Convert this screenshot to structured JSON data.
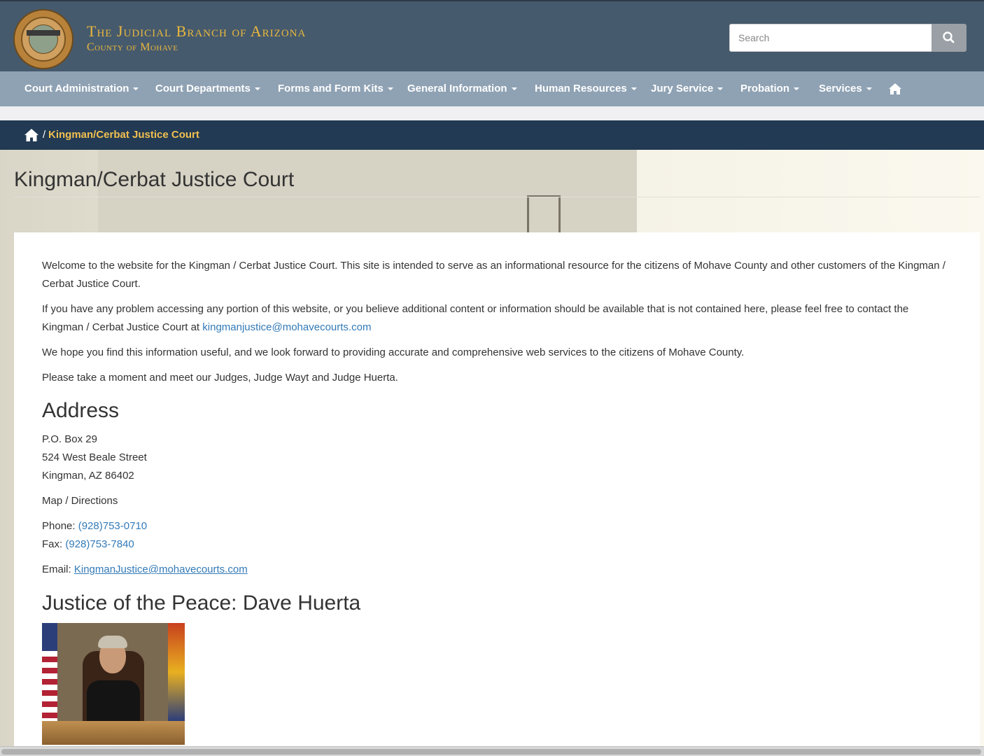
{
  "header": {
    "title": "The Judicial Branch of Arizona",
    "subtitle": "County of Mohave",
    "seal_motto": "DITAT DEUS",
    "search_placeholder": "Search"
  },
  "nav": {
    "items": [
      {
        "label": "Court Administration"
      },
      {
        "label": "Court Departments"
      },
      {
        "label": "Forms and Form Kits"
      },
      {
        "label": "General Information"
      },
      {
        "label": "Human Resources"
      },
      {
        "label": "Jury Service"
      },
      {
        "label": "Probation"
      },
      {
        "label": "Services"
      }
    ]
  },
  "breadcrumb": {
    "separator": "/",
    "current": "Kingman/Cerbat Justice Court"
  },
  "page": {
    "title": "Kingman/Cerbat Justice Court",
    "intro_1": "Welcome to the website for the Kingman / Cerbat Justice Court. This site is intended to serve as an informational resource for the citizens of Mohave County and other customers of the Kingman / Cerbat Justice Court.",
    "intro_2_text": "If you have any problem accessing any portion of this website, or you believe additional content or information should be available that is not contained here, please feel free to contact the Kingman / Cerbat Justice Court at ",
    "intro_2_link": "kingmanjustice@mohavecourts.com",
    "intro_3": "We hope you find this information useful, and we look forward to providing accurate and comprehensive web services to the citizens of Mohave County.",
    "intro_4": "Please take a moment and meet our Judges, Judge Wayt and Judge Huerta."
  },
  "address": {
    "heading": "Address",
    "line_1": "P.O. Box 29",
    "line_2": "524 West Beale Street",
    "line_3": "Kingman, AZ 86402",
    "map_link": "Map / Directions",
    "phone_label": "Phone:",
    "phone": "(928)753-0710",
    "fax_label": "Fax:",
    "fax": "(928)753-7840",
    "email_label": "Email:",
    "email": "KingmanJustice@mohavecourts.com"
  },
  "judge": {
    "heading": "Justice of the Peace: Dave Huerta"
  },
  "colors": {
    "header_bg": "#465a6d",
    "nav_bg": "#8fa2b4",
    "breadcrumb_bg": "#223a53",
    "accent_gold": "#e8b83d",
    "link": "#337ab7"
  },
  "icons": {
    "search": "search-icon",
    "home": "home-icon",
    "caret": "caret-down-icon"
  }
}
